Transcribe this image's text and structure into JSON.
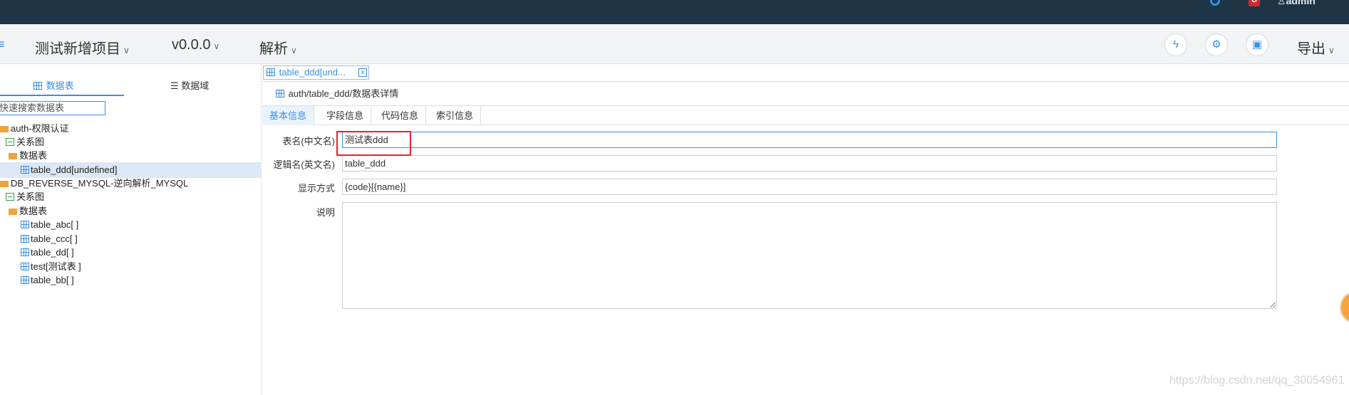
{
  "topbar": {
    "user_label": "admin",
    "icons": [
      "github-icon",
      "gitee-icon",
      "user-icon"
    ]
  },
  "header": {
    "project_name": "测试新增项目",
    "version": "v0.0.0",
    "parse_menu": "解析",
    "export_menu": "导出",
    "chevron": "∨",
    "buttons": [
      "lightning-icon",
      "gear-icon",
      "save-icon"
    ]
  },
  "left_panel": {
    "tabs": [
      {
        "label": "数据表",
        "active": true
      },
      {
        "label": "数据域",
        "active": false
      }
    ],
    "search_placeholder": "快速搜索数据表",
    "tree": [
      {
        "type": "folder",
        "label": "auth-权限认证",
        "indent": 0
      },
      {
        "type": "relation",
        "label": "关系图",
        "indent": 1
      },
      {
        "type": "folder",
        "label": "数据表",
        "indent": 1
      },
      {
        "type": "table",
        "label": "table_ddd[undefined]",
        "indent": 2,
        "selected": true
      },
      {
        "type": "folder",
        "label": "DB_REVERSE_MYSQL-逆向解析_MYSQL",
        "indent": 0
      },
      {
        "type": "relation",
        "label": "关系图",
        "indent": 1
      },
      {
        "type": "folder",
        "label": "数据表",
        "indent": 1
      },
      {
        "type": "table",
        "label": "table_abc[ ]",
        "indent": 2
      },
      {
        "type": "table",
        "label": "table_ccc[ ]",
        "indent": 2
      },
      {
        "type": "table",
        "label": "table_dd[ ]",
        "indent": 2
      },
      {
        "type": "table",
        "label": "test[测试表 ]",
        "indent": 2
      },
      {
        "type": "table",
        "label": "table_bb[ ]",
        "indent": 2
      }
    ]
  },
  "main": {
    "doc_tab_label": "table_ddd[und...",
    "doc_tab_close": "x",
    "breadcrumb": "auth/table_ddd/数据表详情",
    "sub_tabs": [
      {
        "label": "基本信息",
        "active": true
      },
      {
        "label": "字段信息",
        "active": false
      },
      {
        "label": "代码信息",
        "active": false
      },
      {
        "label": "索引信息",
        "active": false
      }
    ],
    "form": {
      "cn_name_label": "表名(中文名)",
      "cn_name_value": "测试表ddd",
      "en_name_label": "逻辑名(英文名)",
      "en_name_value": "table_ddd",
      "display_label": "显示方式",
      "display_value": "{code}[{name}]",
      "desc_label": "说明",
      "desc_value": ""
    }
  },
  "watermark": "https://blog.csdn.net/qq_30054961",
  "colors": {
    "topbar": "#1d3446",
    "accent": "#3a8ee6",
    "highlight": "#e8222b",
    "folder": "#f0a33a"
  }
}
